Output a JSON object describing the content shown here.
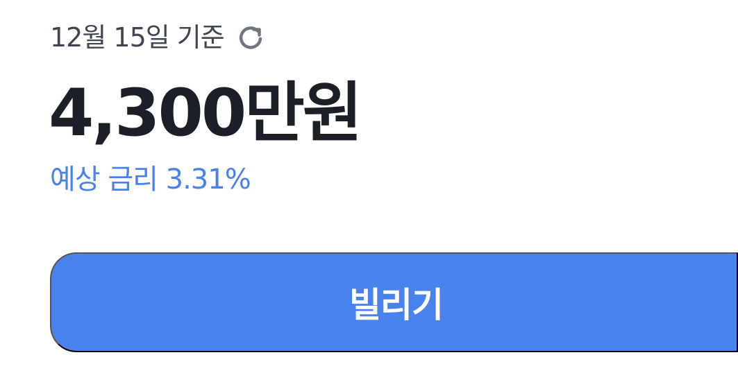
{
  "header": {
    "as_of_text": "12월 15일 기준",
    "refresh_icon": "refresh-icon"
  },
  "summary": {
    "amount": "4,300만원",
    "rate_text": "예상 금리 3.31%"
  },
  "action": {
    "borrow_label": "빌리기"
  },
  "colors": {
    "accent": "#4a82ed",
    "primary_text": "#1b1f27",
    "secondary_text": "#3f4652",
    "icon_gray": "#6f7682"
  }
}
